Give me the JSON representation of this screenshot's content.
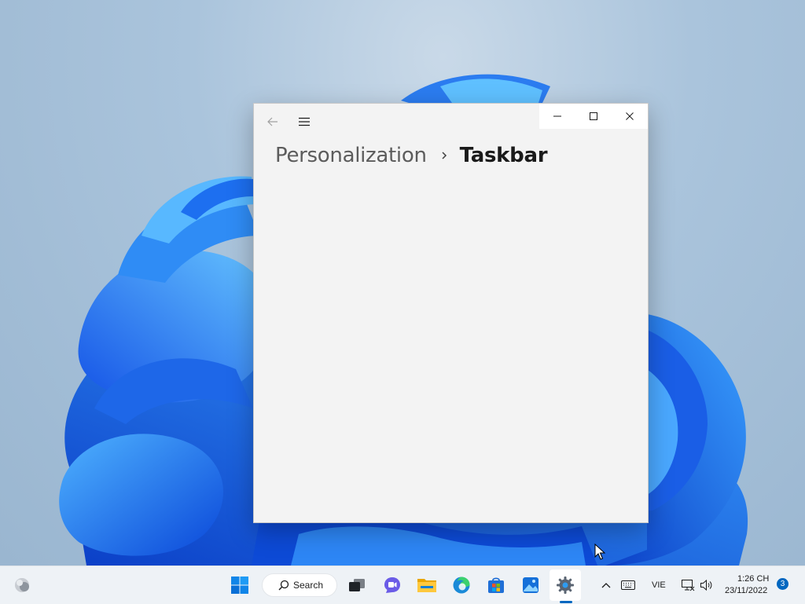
{
  "window": {
    "breadcrumb_parent": "Personalization",
    "breadcrumb_current": "Taskbar",
    "accent_color": "#0067c0"
  },
  "taskbar": {
    "search_label": "Search",
    "language": "VIE",
    "time": "1:26 CH",
    "date": "23/11/2022",
    "notification_count": "3",
    "pinned_apps": [
      "start-icon",
      "search-icon",
      "task-view-icon",
      "teams-chat-icon",
      "file-explorer-icon",
      "edge-icon",
      "microsoft-store-icon",
      "photos-icon",
      "settings-icon"
    ],
    "tray_icons": [
      "chevron-up-icon",
      "keyboard-icon",
      "network-icon",
      "volume-icon"
    ]
  }
}
